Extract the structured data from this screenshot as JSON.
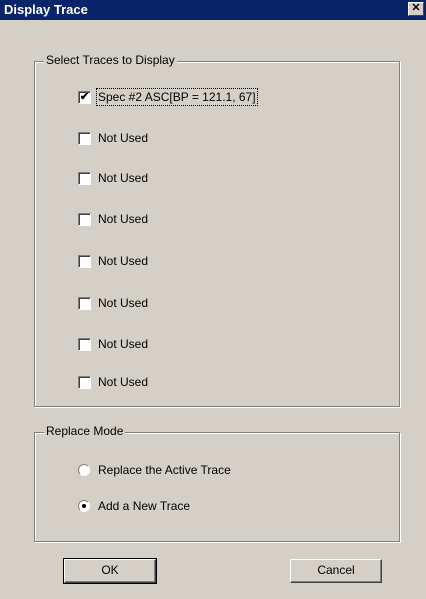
{
  "window": {
    "title": "Display Trace",
    "close_glyph": "✕"
  },
  "select_group": {
    "legend": "Select Traces to Display",
    "items": [
      {
        "label": "Spec #2 ASC[BP = 121.1, 67]",
        "checked": true
      },
      {
        "label": "Not Used",
        "checked": false
      },
      {
        "label": "Not Used",
        "checked": false
      },
      {
        "label": "Not Used",
        "checked": false
      },
      {
        "label": "Not Used",
        "checked": false
      },
      {
        "label": "Not Used",
        "checked": false
      },
      {
        "label": "Not Used",
        "checked": false
      },
      {
        "label": "Not Used",
        "checked": false
      }
    ]
  },
  "replace_group": {
    "legend": "Replace Mode",
    "options": [
      {
        "label": "Replace the Active Trace",
        "selected": false
      },
      {
        "label": "Add a New Trace",
        "selected": true
      }
    ]
  },
  "buttons": {
    "ok": "OK",
    "cancel": "Cancel"
  },
  "glyphs": {
    "check": "✔"
  }
}
